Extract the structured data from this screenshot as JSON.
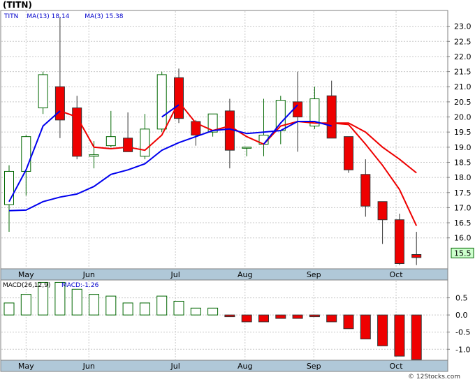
{
  "chart_data": [
    {
      "type": "candlestick",
      "title": "(TITN)",
      "legend": [
        {
          "label": "TITN",
          "color": "#0000cc"
        },
        {
          "label": "MA(13)",
          "value": "18.14",
          "color": "#0000cc"
        },
        {
          "label": "MA(3)",
          "value": "15.38",
          "color": "#0000cc"
        }
      ],
      "ylim": [
        15.0,
        23.5
      ],
      "y_ticks": [
        "16.0",
        "16.5",
        "17.0",
        "17.5",
        "18.0",
        "18.5",
        "19.0",
        "19.5",
        "20.0",
        "20.5",
        "21.0",
        "21.5",
        "22.0",
        "22.5",
        "23.0"
      ],
      "x_labels": [
        "May",
        "Jun",
        "Jul",
        "Aug",
        "Sep",
        "Oct"
      ],
      "x_label_positions": [
        1.0,
        4.7,
        9.8,
        13.9,
        17.95,
        22.8
      ],
      "last_price": "15.5",
      "candles": [
        {
          "x": 0,
          "open": 17.1,
          "close": 18.2,
          "high": 18.4,
          "low": 16.2
        },
        {
          "x": 1,
          "open": 18.2,
          "close": 19.35,
          "high": 19.4,
          "low": 17.4
        },
        {
          "x": 2,
          "open": 20.3,
          "close": 21.4,
          "high": 21.5,
          "low": 20.1
        },
        {
          "x": 3,
          "open": 21.0,
          "close": 19.9,
          "high": 23.3,
          "low": 19.3
        },
        {
          "x": 4,
          "open": 20.3,
          "close": 18.7,
          "high": 20.7,
          "low": 18.6
        },
        {
          "x": 5,
          "open": 18.7,
          "close": 18.75,
          "high": 19.2,
          "low": 18.3
        },
        {
          "x": 6,
          "open": 19.05,
          "close": 19.35,
          "high": 20.2,
          "low": 19.0
        },
        {
          "x": 7,
          "open": 19.3,
          "close": 18.85,
          "high": 20.15,
          "low": 18.85
        },
        {
          "x": 8,
          "open": 18.7,
          "close": 19.6,
          "high": 20.1,
          "low": 18.6
        },
        {
          "x": 9,
          "open": 19.6,
          "close": 21.4,
          "high": 21.5,
          "low": 19.5
        },
        {
          "x": 10,
          "open": 21.3,
          "close": 19.95,
          "high": 21.6,
          "low": 19.8
        },
        {
          "x": 11,
          "open": 19.85,
          "close": 19.4,
          "high": 19.9,
          "low": 19.05
        },
        {
          "x": 12,
          "open": 19.5,
          "close": 20.1,
          "high": 20.1,
          "low": 19.35
        },
        {
          "x": 13,
          "open": 20.2,
          "close": 18.9,
          "high": 20.6,
          "low": 18.3
        },
        {
          "x": 14,
          "open": 19.0,
          "close": 19.0,
          "high": 19.0,
          "low": 18.7
        },
        {
          "x": 15,
          "open": 19.1,
          "close": 19.4,
          "high": 20.6,
          "low": 18.7
        },
        {
          "x": 16,
          "open": 19.55,
          "close": 20.55,
          "high": 20.7,
          "low": 19.1
        },
        {
          "x": 17,
          "open": 20.5,
          "close": 20.0,
          "high": 21.5,
          "low": 18.85
        },
        {
          "x": 18,
          "open": 19.7,
          "close": 20.6,
          "high": 21.0,
          "low": 19.6
        },
        {
          "x": 19,
          "open": 20.7,
          "close": 19.3,
          "high": 21.2,
          "low": 19.3
        },
        {
          "x": 20,
          "open": 19.35,
          "close": 18.25,
          "high": 19.35,
          "low": 18.15
        },
        {
          "x": 21,
          "open": 18.1,
          "close": 17.05,
          "high": 18.6,
          "low": 16.7
        },
        {
          "x": 22,
          "open": 17.2,
          "close": 16.6,
          "high": 17.2,
          "low": 15.8
        },
        {
          "x": 23,
          "open": 16.6,
          "close": 15.15,
          "high": 16.8,
          "low": 15.1
        },
        {
          "x": 24,
          "open": 15.45,
          "close": 15.35,
          "high": 16.2,
          "low": 15.1
        }
      ],
      "ma_red": {
        "color": "#ee0000",
        "values": [
          null,
          null,
          null,
          20.2,
          20.0,
          19.0,
          18.95,
          19.0,
          18.9,
          19.4,
          20.5,
          19.8,
          19.55,
          19.7,
          19.35,
          19.1,
          19.7,
          19.85,
          19.8,
          19.8,
          19.75,
          19.1,
          18.4,
          17.6,
          16.4
        ]
      },
      "ma_blue": {
        "color": "#0000ee",
        "values": [
          17.2,
          18.25,
          19.7,
          20.2,
          null,
          null,
          null,
          null,
          null,
          20.0,
          20.4,
          null,
          20.0,
          null,
          null,
          19.1,
          19.8,
          20.4,
          null,
          null,
          null,
          null,
          null,
          null,
          null
        ]
      },
      "ma_blue_lower": {
        "color": "#0000ee",
        "values": [
          16.9,
          16.92,
          17.2,
          17.35,
          17.45,
          17.7,
          18.1,
          18.25,
          18.45,
          18.9,
          19.15,
          19.35,
          19.55,
          19.6,
          19.45,
          19.5,
          19.55,
          19.85,
          19.85,
          19.7,
          null,
          null,
          null,
          null,
          null
        ]
      },
      "ma_red_late": {
        "color": "#ee0000",
        "values": [
          null,
          null,
          null,
          null,
          null,
          null,
          null,
          null,
          null,
          null,
          null,
          null,
          null,
          null,
          null,
          null,
          null,
          null,
          null,
          19.8,
          19.8,
          19.5,
          19.0,
          18.6,
          18.15
        ]
      }
    },
    {
      "type": "bar",
      "title": "MACD(26,12,9)",
      "subtitle": "MACD:-1.26",
      "ylim": [
        -1.3,
        1.0
      ],
      "y_ticks": [
        "0.5",
        "0.0",
        "-0.5",
        "-1.0"
      ],
      "x_labels": [
        "May",
        "Jun",
        "Jul",
        "Aug",
        "Sep",
        "Oct"
      ],
      "values": [
        0.35,
        0.6,
        0.95,
        0.95,
        0.75,
        0.6,
        0.55,
        0.35,
        0.35,
        0.55,
        0.4,
        0.2,
        0.2,
        -0.05,
        -0.2,
        -0.2,
        -0.1,
        -0.1,
        -0.05,
        -0.2,
        -0.4,
        -0.7,
        -0.9,
        -1.2,
        -1.3
      ]
    }
  ],
  "footer": {
    "copyright": "© 12Stocks.com"
  }
}
